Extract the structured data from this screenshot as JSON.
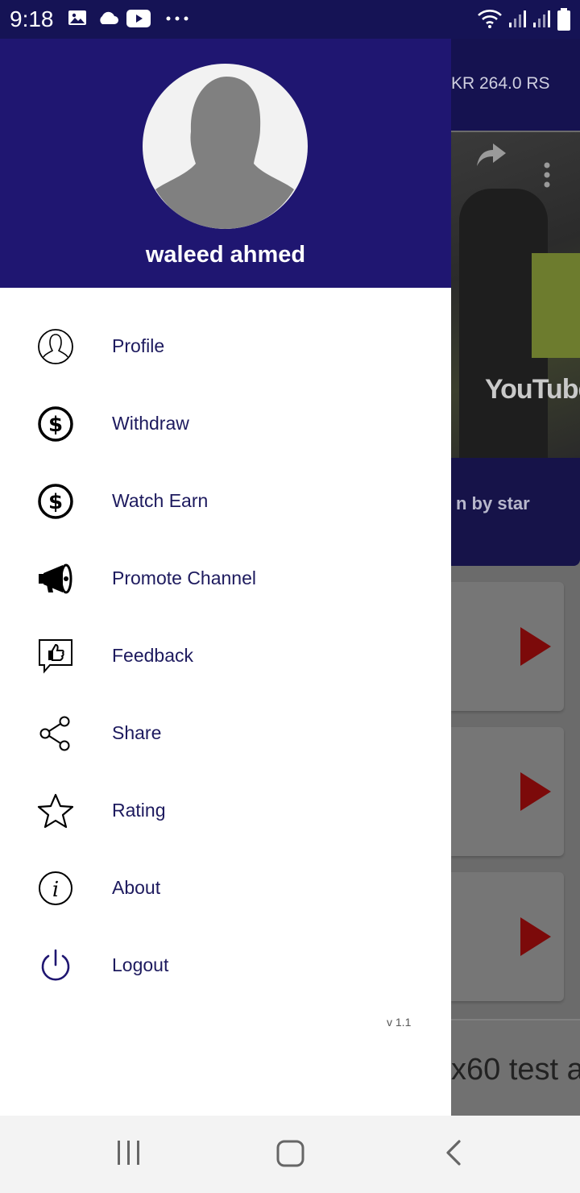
{
  "status_bar": {
    "time": "9:18"
  },
  "background_app": {
    "balance_text": "KR  264.0  RS",
    "video_label": "YouTube",
    "video_title_fragment": "n by star",
    "bottom_text_fragment": "x60 test a"
  },
  "drawer": {
    "user_name": "waleed ahmed",
    "menu": [
      {
        "label": "Profile",
        "icon": "profile-icon"
      },
      {
        "label": "Withdraw",
        "icon": "dollar-icon"
      },
      {
        "label": "Watch Earn",
        "icon": "dollar-icon"
      },
      {
        "label": "Promote Channel",
        "icon": "megaphone-icon"
      },
      {
        "label": "Feedback",
        "icon": "feedback-icon"
      },
      {
        "label": "Share",
        "icon": "share-icon"
      },
      {
        "label": "Rating",
        "icon": "star-icon"
      },
      {
        "label": "About",
        "icon": "info-icon"
      },
      {
        "label": "Logout",
        "icon": "power-icon"
      }
    ],
    "version": "v 1.1"
  },
  "colors": {
    "drawer_header": "#1f1671",
    "menu_text": "#1d1a5e",
    "play_red": "#7c0a0a"
  }
}
